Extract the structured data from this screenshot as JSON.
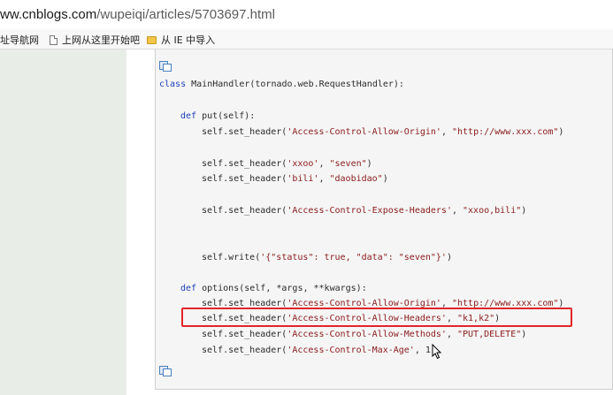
{
  "browser": {
    "url_host": "ww.cnblogs.com",
    "url_path": "/wupeiqi/articles/5703697.html"
  },
  "bookmarks": [
    {
      "label": "址导航网",
      "icon": "none"
    },
    {
      "label": "上网从这里开始吧",
      "icon": "document-icon"
    },
    {
      "label": "从 IE 中导入",
      "icon": "folder-icon"
    }
  ],
  "code": {
    "lines": [
      {
        "indent": 0,
        "kw": "class",
        "text": " MainHandler(tornado.web.RequestHandler):"
      },
      {
        "indent": 1,
        "kw": "def",
        "text": " put(self):"
      },
      {
        "indent": 2,
        "call": "self.set_header(",
        "args": [
          {
            "s": "'Access-Control-Allow-Origin'"
          },
          {
            "p": ", "
          },
          {
            "s": "\"http://www.xxx.com\""
          },
          {
            "p": ")"
          }
        ]
      },
      {
        "indent": 2,
        "call": "self.set_header(",
        "args": [
          {
            "s": "'xxoo'"
          },
          {
            "p": ", "
          },
          {
            "s": "\"seven\""
          },
          {
            "p": ")"
          }
        ]
      },
      {
        "indent": 2,
        "call": "self.set_header(",
        "args": [
          {
            "s": "'bili'"
          },
          {
            "p": ", "
          },
          {
            "s": "\"daobidao\""
          },
          {
            "p": ")"
          }
        ]
      },
      {
        "indent": 2,
        "call": "self.set_header(",
        "args": [
          {
            "s": "'Access-Control-Expose-Headers'"
          },
          {
            "p": ", "
          },
          {
            "s": "\"xxoo,bili\""
          },
          {
            "p": ")"
          }
        ]
      },
      {
        "indent": 2,
        "call": "self.write(",
        "args": [
          {
            "s": "'{\"status\": true, \"data\": \"seven\"}'"
          },
          {
            "p": ")"
          }
        ]
      },
      {
        "indent": 1,
        "kw": "def",
        "text": " options(self, *args, **kwargs):"
      },
      {
        "indent": 2,
        "call": "self.set_header(",
        "args": [
          {
            "s": "'Access-Control-Allow-Origin'"
          },
          {
            "p": ", "
          },
          {
            "s": "\"http://www.xxx.com\""
          },
          {
            "p": ")"
          }
        ]
      },
      {
        "indent": 2,
        "call": "self.set_header(",
        "args": [
          {
            "s": "'Access-Control-Allow-Headers'"
          },
          {
            "p": ", "
          },
          {
            "s": "\"k1,k2\""
          },
          {
            "p": ")"
          }
        ]
      },
      {
        "indent": 2,
        "call": "self.set_header(",
        "args": [
          {
            "s": "'Access-Control-Allow-Methods'"
          },
          {
            "p": ", "
          },
          {
            "s": "\"PUT,DELETE\""
          },
          {
            "p": ")"
          }
        ]
      },
      {
        "indent": 2,
        "call": "self.set_header(",
        "args": [
          {
            "s": "'Access-Control-Max-Age'"
          },
          {
            "p": ", 1"
          }
        ]
      }
    ]
  },
  "colors": {
    "keyword": "#1b3fb8",
    "string": "#8a1a1a",
    "highlight_border": "#e2242b",
    "sidebar_bg": "#e9ede8",
    "code_bg": "#f5f5f5"
  }
}
